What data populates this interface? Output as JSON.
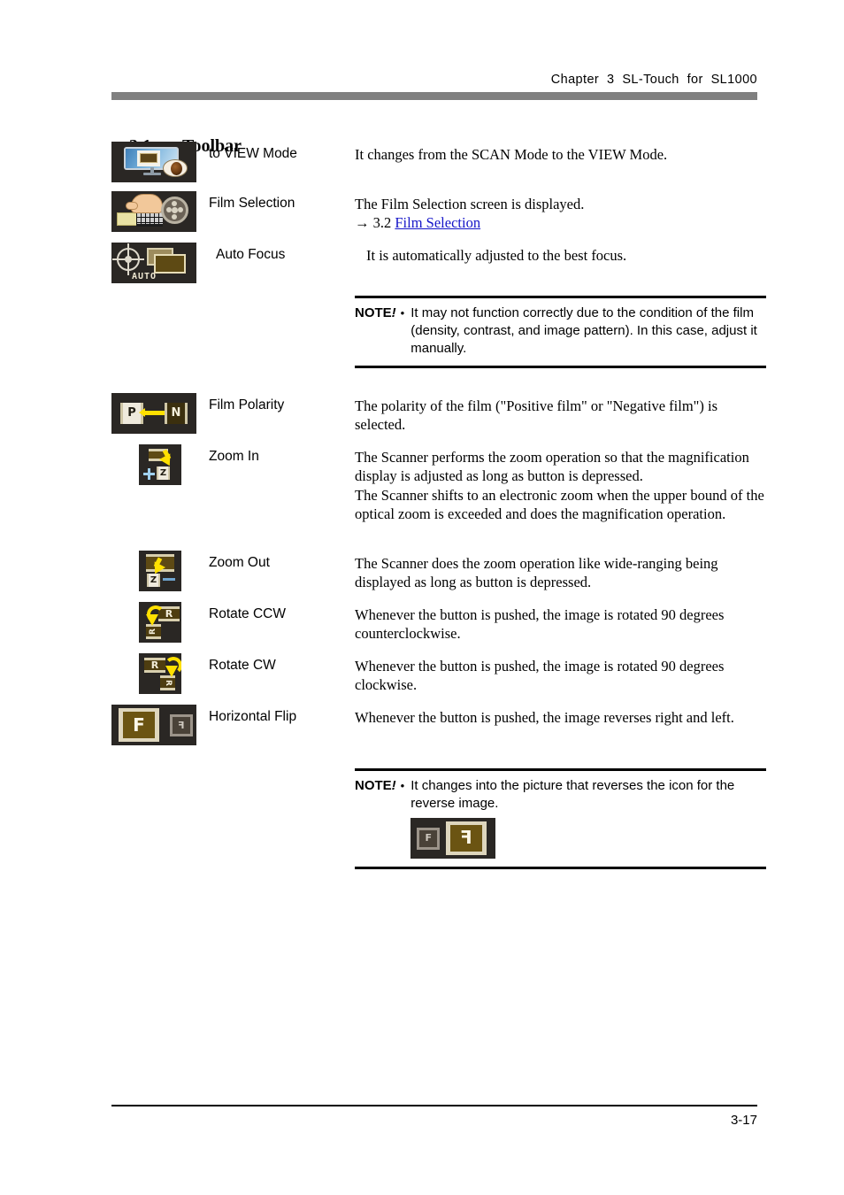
{
  "header": {
    "chapter_text": "Chapter  3  SL-Touch  for  SL1000"
  },
  "section": {
    "number": "3.1",
    "title": "Toolbar"
  },
  "rows": [
    {
      "icon_name": "to-view-mode-icon",
      "label": "to VIEW Mode",
      "description": "It changes from the SCAN Mode to the VIEW Mode."
    },
    {
      "icon_name": "film-selection-icon",
      "label": "Film Selection",
      "description": "The Film Selection screen is displayed.",
      "ref_arrow": "→",
      "ref_number": "3.2",
      "ref_link": "Film Selection"
    },
    {
      "icon_name": "auto-focus-icon",
      "label": "Auto Focus",
      "description": "It is automatically adjusted to the best focus.",
      "icon_text": "AUTO"
    },
    {
      "icon_name": "film-polarity-icon",
      "label": "Film Polarity",
      "description": "The polarity of the film (\"Positive film\" or \"Negative film\") is selected.",
      "icon_left_glyph": "P",
      "icon_right_glyph": "N"
    },
    {
      "icon_name": "zoom-in-icon",
      "label": "Zoom In",
      "description_p1": "The Scanner performs the zoom operation so that the magnification display is adjusted as long as button is depressed.",
      "description_p2": "The Scanner shifts to an electronic zoom when the upper bound of the optical zoom is exceeded and does the magnification operation.",
      "icon_glyph": "Z"
    },
    {
      "icon_name": "zoom-out-icon",
      "label": "Zoom Out",
      "description": "The Scanner does the zoom operation like wide-ranging being displayed as long as button is depressed.",
      "icon_glyph": "Z"
    },
    {
      "icon_name": "rotate-ccw-icon",
      "label": "Rotate CCW",
      "description": "Whenever the button is pushed, the image is rotated 90 degrees counterclockwise.",
      "icon_glyph": "R"
    },
    {
      "icon_name": "rotate-cw-icon",
      "label": "Rotate CW",
      "description": "Whenever the button is pushed, the image is rotated 90 degrees clockwise.",
      "icon_glyph": "R"
    },
    {
      "icon_name": "horizontal-flip-icon",
      "label": "Horizontal Flip",
      "description": "Whenever the button is pushed, the image reverses right and left.",
      "icon_glyph": "F"
    }
  ],
  "note_auto_focus": {
    "label": "NOTE",
    "bang": "!",
    "bullet": "•",
    "text": "It may not function correctly due to the condition of the film (density, contrast, and image pattern). In this case, adjust it manually."
  },
  "note_flip": {
    "label": "NOTE",
    "bang": "!",
    "bullet": "•",
    "text": "It changes into the picture that reverses the icon for the reverse image.",
    "icon_name": "horizontal-flip-reversed-icon",
    "icon_glyph": "F"
  },
  "footer": {
    "page_number": "3-17"
  },
  "colors": {
    "header_bar": "#808080",
    "link": "#1414c8",
    "icon_tile_bg": "#2a2724",
    "icon_accent_yellow": "#ffe000"
  }
}
